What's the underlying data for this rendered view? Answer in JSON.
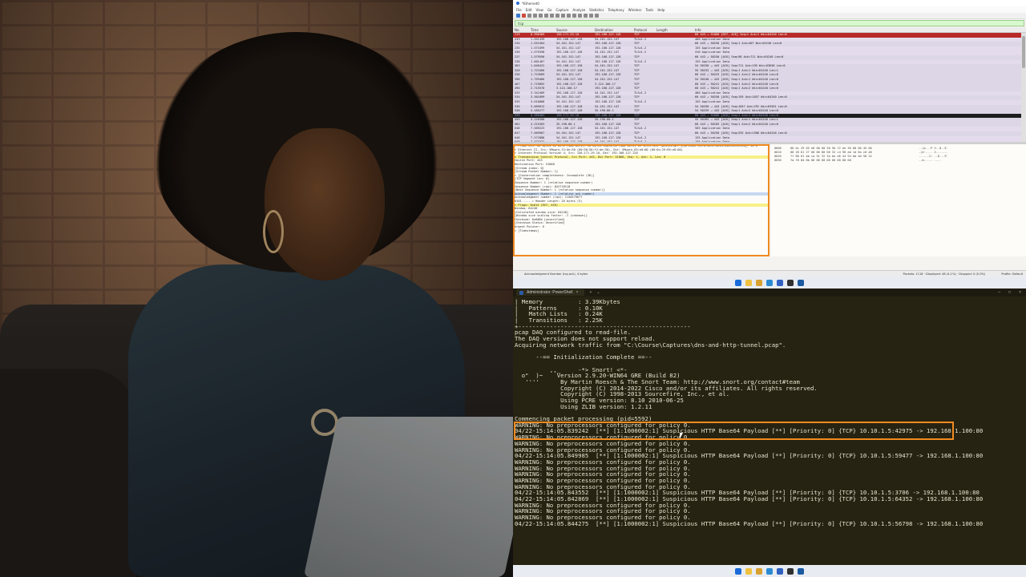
{
  "wireshark": {
    "title": "*Ethernet0",
    "menu": [
      "File",
      "Edit",
      "View",
      "Go",
      "Capture",
      "Analyze",
      "Statistics",
      "Telephony",
      "Wireless",
      "Tools",
      "Help"
    ],
    "filter": "tcp",
    "columns": [
      "No.",
      "Time",
      "Source",
      "Destination",
      "Protocol",
      "Length",
      "Info"
    ],
    "packets": [
      {
        "no": "219",
        "time": "0.996369",
        "src": "150.171.29.10",
        "dst": "192.168.127.128",
        "proto": "TCP",
        "info": "60 443 → 51868 [RST, ACK] Seq=1 Ack=1 Win=64240 Len=0",
        "style": "red"
      },
      {
        "no": "233",
        "time": "1.551339",
        "src": "192.168.127.128",
        "dst": "54.161.152.147",
        "proto": "TLSv1.2",
        "info": "460 Application Data",
        "style": "tls"
      },
      {
        "no": "234",
        "time": "1.551564",
        "src": "54.161.152.147",
        "dst": "192.168.127.128",
        "proto": "TCP",
        "info": "60 443 → 50250 [ACK] Seq=1 Ack=407 Win=64240 Len=0",
        "style": "tcp"
      },
      {
        "no": "235",
        "time": "1.571699",
        "src": "54.161.152.147",
        "dst": "192.168.127.128",
        "proto": "TLSv1.2",
        "info": "155 Application Data",
        "style": "tls"
      },
      {
        "no": "236",
        "time": "1.579358",
        "src": "192.168.127.128",
        "dst": "54.161.152.147",
        "proto": "TLSv1.2",
        "info": "410 Application Data",
        "style": "tls"
      },
      {
        "no": "237",
        "time": "1.579556",
        "src": "54.161.152.147",
        "dst": "192.168.127.128",
        "proto": "TCP",
        "info": "60 443 → 50250 [ACK] Seq=98 Ack=711 Win=64240 Len=0",
        "style": "tcp"
      },
      {
        "no": "238",
        "time": "1.601467",
        "src": "54.161.152.147",
        "dst": "192.168.127.128",
        "proto": "TLSv1.2",
        "info": "155 Application Data",
        "style": "tls"
      },
      {
        "no": "383",
        "time": "1.646422",
        "src": "192.168.127.128",
        "dst": "54.161.152.147",
        "proto": "TCP",
        "info": "54 50250 → 443 [ACK] Seq=711 Ack=195 Win=63658 Len=0",
        "style": "tcp"
      },
      {
        "no": "328",
        "time": "1.723466",
        "src": "192.168.127.128",
        "dst": "54.161.152.147",
        "proto": "TCP",
        "info": "55 50253 → 443 [ACK] Seq=1 Ack=1 Win=64240 Len=1",
        "style": "tcp"
      },
      {
        "no": "330",
        "time": "1.723689",
        "src": "54.161.152.147",
        "dst": "192.168.127.128",
        "proto": "TCP",
        "info": "60 443 → 50253 [ACK] Seq=1 Ack=2 Win=64240 Len=0",
        "style": "tcp"
      },
      {
        "no": "398",
        "time": "1.759466",
        "src": "192.168.127.128",
        "dst": "54.161.152.147",
        "proto": "TCP",
        "info": "54 50240 → 443 [ACK] Seq=1 Ack=1 Win=64240 Len=0",
        "style": "tcp"
      },
      {
        "no": "467",
        "time": "2.719092",
        "src": "192.168.127.128",
        "dst": "3.124.100.17",
        "proto": "TCP",
        "info": "60 443 → 50241 [ACK] Seq=1 Ack=2 Win=64240 Len=0",
        "style": "tcp"
      },
      {
        "no": "490",
        "time": "2.715570",
        "src": "3.124.100.17",
        "dst": "192.168.127.128",
        "proto": "TCP",
        "info": "60 443 → 50241 [ACK] Seq=1 Ack=2 Win=64240 Len=0",
        "style": "tcp"
      },
      {
        "no": "533",
        "time": "3.342489",
        "src": "192.168.127.128",
        "dst": "54.161.152.147",
        "proto": "TLSv1.2",
        "info": "460 Application Data",
        "style": "tls"
      },
      {
        "no": "534",
        "time": "3.361899",
        "src": "54.161.152.147",
        "dst": "192.168.127.128",
        "proto": "TCP",
        "info": "60 443 → 50250 [ACK] Seq=195 Ack=1057 Win=64240 Len=0",
        "style": "tcp"
      },
      {
        "no": "535",
        "time": "3.610068",
        "src": "54.161.152.147",
        "dst": "192.168.127.128",
        "proto": "TLSv1.2",
        "info": "155 Application Data",
        "style": "tls"
      },
      {
        "no": "536",
        "time": "3.669012",
        "src": "192.168.127.128",
        "dst": "54.161.152.147",
        "proto": "TCP",
        "info": "54 50250 → 443 [ACK] Seq=1057 Ack=292 Win=63561 Len=0",
        "style": "tcp"
      },
      {
        "no": "538",
        "time": "4.185277",
        "src": "192.168.127.128",
        "dst": "35.190.80.1",
        "proto": "TCP",
        "info": "54 50259 → 443 [ACK] Seq=1 Ack=2 Win=64240 Len=0",
        "style": "tcp"
      },
      {
        "no": "539",
        "time": "4.185401",
        "src": "150.171.29.10",
        "dst": "192.168.127.128",
        "proto": "TCP",
        "info": "60 443 → 51868 [ACK] Seq=1 Ack=1 Win=64240 Len=0",
        "style": "sel"
      },
      {
        "no": "559",
        "time": "4.220300",
        "src": "192.168.127.128",
        "dst": "35.190.80.1",
        "proto": "TCP",
        "info": "55 50265 → 443 [ACK] Seq=1 Ack=1 Win=64240 Len=1",
        "style": "tcp"
      },
      {
        "no": "562",
        "time": "4.225363",
        "src": "35.190.80.1",
        "dst": "192.168.127.128",
        "proto": "TCP",
        "info": "60 443 → 50165 [ACK] Seq=1 Ack=2 Win=64240 Len=0",
        "style": "tcp"
      },
      {
        "no": "648",
        "time": "7.569223",
        "src": "192.168.127.128",
        "dst": "54.161.152.147",
        "proto": "TLSv1.2",
        "info": "503 Application Data",
        "style": "tls"
      },
      {
        "no": "647",
        "time": "7.569987",
        "src": "54.161.152.147",
        "dst": "192.168.127.128",
        "proto": "TCP",
        "info": "60 443 → 50250 [ACK] Seq=292 Ack=1506 Win=64240 Len=0",
        "style": "tcp"
      },
      {
        "no": "648",
        "time": "7.572888",
        "src": "54.161.152.147",
        "dst": "192.168.127.128",
        "proto": "TLSv1.2",
        "info": "155 Application Data",
        "style": "tls"
      },
      {
        "no": "649",
        "time": "7.573322",
        "src": "192.168.127.128",
        "dst": "54.161.152.147",
        "proto": "TLSv1.2",
        "info": "155 Application Data",
        "style": "tls"
      }
    ],
    "details": [
      {
        "text": "> Frame 219: 60 bytes on wire (480 bits), 60 bytes captured (480 bits) on interface \\Device\\NPF_{CAF5381F-8976-449C-8e56-012C4E159116}, id 0",
        "style": ""
      },
      {
        "text": "> Ethernet II, Src: VMware_f2:de:30 (00:50:56:f2:de:30), Dst: VMware_65:e8:00 (00:0c:29:65:e8:00)",
        "style": ""
      },
      {
        "text": "> Internet Protocol Version 4, Src: 150.171.29.10, Dst: 192.168.127.128",
        "style": ""
      },
      {
        "text": "v Transmission Control Protocol, Src Port: 443, Dst Port: 51868, Seq: 1, Ack: 1, Len: 0",
        "style": "hl"
      },
      {
        "text": "    Source Port: 443",
        "style": ""
      },
      {
        "text": "    Destination Port: 51868",
        "style": ""
      },
      {
        "text": "    [Stream index: 0]",
        "style": ""
      },
      {
        "text": "    [Stream Packet Number: 1]",
        "style": ""
      },
      {
        "text": "  > [Conversation completeness: Incomplete (36)]",
        "style": ""
      },
      {
        "text": "    [TCP Segment Len: 0]",
        "style": ""
      },
      {
        "text": "    Sequence Number: 1    (relative sequence number)",
        "style": ""
      },
      {
        "text": "    Sequence Number (raw): 842718118",
        "style": ""
      },
      {
        "text": "    [Next Sequence Number: 1    (relative sequence number)]",
        "style": ""
      },
      {
        "text": "    Acknowledgment Number: 1    (relative ack number)",
        "style": "sel"
      },
      {
        "text": "    Acknowledgment number (raw): 1150579677",
        "style": ""
      },
      {
        "text": "    0101 .... = Header Length: 20 bytes (5)",
        "style": ""
      },
      {
        "text": "  > Flags: 0x014 (RST, ACK)",
        "style": "hl"
      },
      {
        "text": "    Window: 64240",
        "style": ""
      },
      {
        "text": "    [Calculated window size: 64240]",
        "style": ""
      },
      {
        "text": "    [Window size scaling factor: -1 (unknown)]",
        "style": ""
      },
      {
        "text": "    Checksum: 0x6d8b [unverified]",
        "style": ""
      },
      {
        "text": "    [Checksum Status: Unverified]",
        "style": ""
      },
      {
        "text": "    Urgent Pointer: 0",
        "style": ""
      },
      {
        "text": "  > [Timestamps]",
        "style": ""
      }
    ],
    "hex": [
      {
        "off": "0000",
        "hex": "00 0c 29 65 e8 00 00 50  56 f2 de 30 08 00 45 00",
        "asc": "..)e...P V..0..E."
      },
      {
        "off": "0010",
        "hex": "00 28 61 27 00 00 80 06  32 c4 96 ab 1d 0a c0 a8",
        "asc": ".(a'.... 2......."
      },
      {
        "off": "0020",
        "hex": "7f 80 01 bb ca 9c 32 3a  ba a6 44 94 bb dd 50 14",
        "asc": "......2: ..D...P."
      },
      {
        "off": "0030",
        "hex": "fa f0 6d 8b 00 00 00 00  00 00 00 00",
        "asc": "..m..... ...."
      }
    ],
    "status_left": "Acknowledgment Number (tcp.ack), 4 bytes",
    "status_right": "Packets: 1118 · Displayed: 46 (4.1%) · Dropped: 0 (0.0%)",
    "status_profile": "Profile: Default"
  },
  "terminal": {
    "tab_title": "Administrator: PowerShell",
    "lines": [
      "| Memory          : 3.39Kbytes",
      "|   Patterns      : 0.10K",
      "|   Match Lists   : 0.24K",
      "|   Transitions   : 2.25K",
      "+-------------------------------------------------",
      "pcap DAQ configured to read-file.",
      "The DAQ version does not support reload.",
      "Acquiring network traffic from \"C:\\Course\\Captures\\dns-and-http-tunnel.pcap\".",
      "",
      "      --== Initialization Complete ==--",
      "",
      "          ,,_     -*> Snort! <*-",
      "  o\"  )~    Version 2.9.20-WIN64 GRE (Build 82)",
      "   ''''      By Martin Roesch & The Snort Team: http://www.snort.org/contact#team",
      "             Copyright (C) 2014-2022 Cisco and/or its affiliates. All rights reserved.",
      "             Copyright (C) 1998-2013 Sourcefire, Inc., et al.",
      "             Using PCRE version: 8.10 2010-06-25",
      "             Using ZLIB version: 1.2.11",
      "",
      "Commencing packet processing (pid=5592)",
      "WARNING: No preprocessors configured for policy 0.",
      "04/22-15:14:05.839242  [**] [1:1000002:1] Suspicious HTTP Base64 Payload [**] [Priority: 0] {TCP} 10.10.1.5:42975 -> 192.168.1.100:80",
      "WARNING: No preprocessors configured for policy 0.",
      "WARNING: No preprocessors configured for policy 0.",
      "WARNING: No preprocessors configured for policy 0.",
      "04/22-15:14:05.849985  [**] [1:1000002:1] Suspicious HTTP Base64 Payload [**] [Priority: 0] {TCP} 10.10.1.5:59477 -> 192.168.1.100:80",
      "WARNING: No preprocessors configured for policy 0.",
      "WARNING: No preprocessors configured for policy 0.",
      "WARNING: No preprocessors configured for policy 0.",
      "WARNING: No preprocessors configured for policy 0.",
      "WARNING: No preprocessors configured for policy 0.",
      "04/22-15:14:05.843552  [**] [1:1000002:1] Suspicious HTTP Base64 Payload [**] [Priority: 0] {TCP} 10.10.1.5:3706 -> 192.168.1.100:80",
      "04/22-15:14:05.842869  [**] [1:1000002:1] Suspicious HTTP Base64 Payload [**] [Priority: 0] {TCP} 10.10.1.5:64352 -> 192.168.1.100:80",
      "WARNING: No preprocessors configured for policy 0.",
      "WARNING: No preprocessors configured for policy 0.",
      "WARNING: No preprocessors configured for policy 0.",
      "04/22-15:14:05.844275  [**] [1:1000002:1] Suspicious HTTP Base64 Payload [**] [Priority: 0] {TCP} 10.10.1.5:56798 -> 192.168.1.100:80"
    ]
  },
  "colors": {
    "highlight_box": "#f08a20",
    "terminal_bg": "#262312",
    "packet_red": "#b82a28",
    "filter_green": "#d8f8d0"
  },
  "taskbar_icons": [
    "windows-icon",
    "search-icon",
    "explorer-icon",
    "edge-icon",
    "store-icon",
    "terminal-icon",
    "wireshark-icon"
  ]
}
